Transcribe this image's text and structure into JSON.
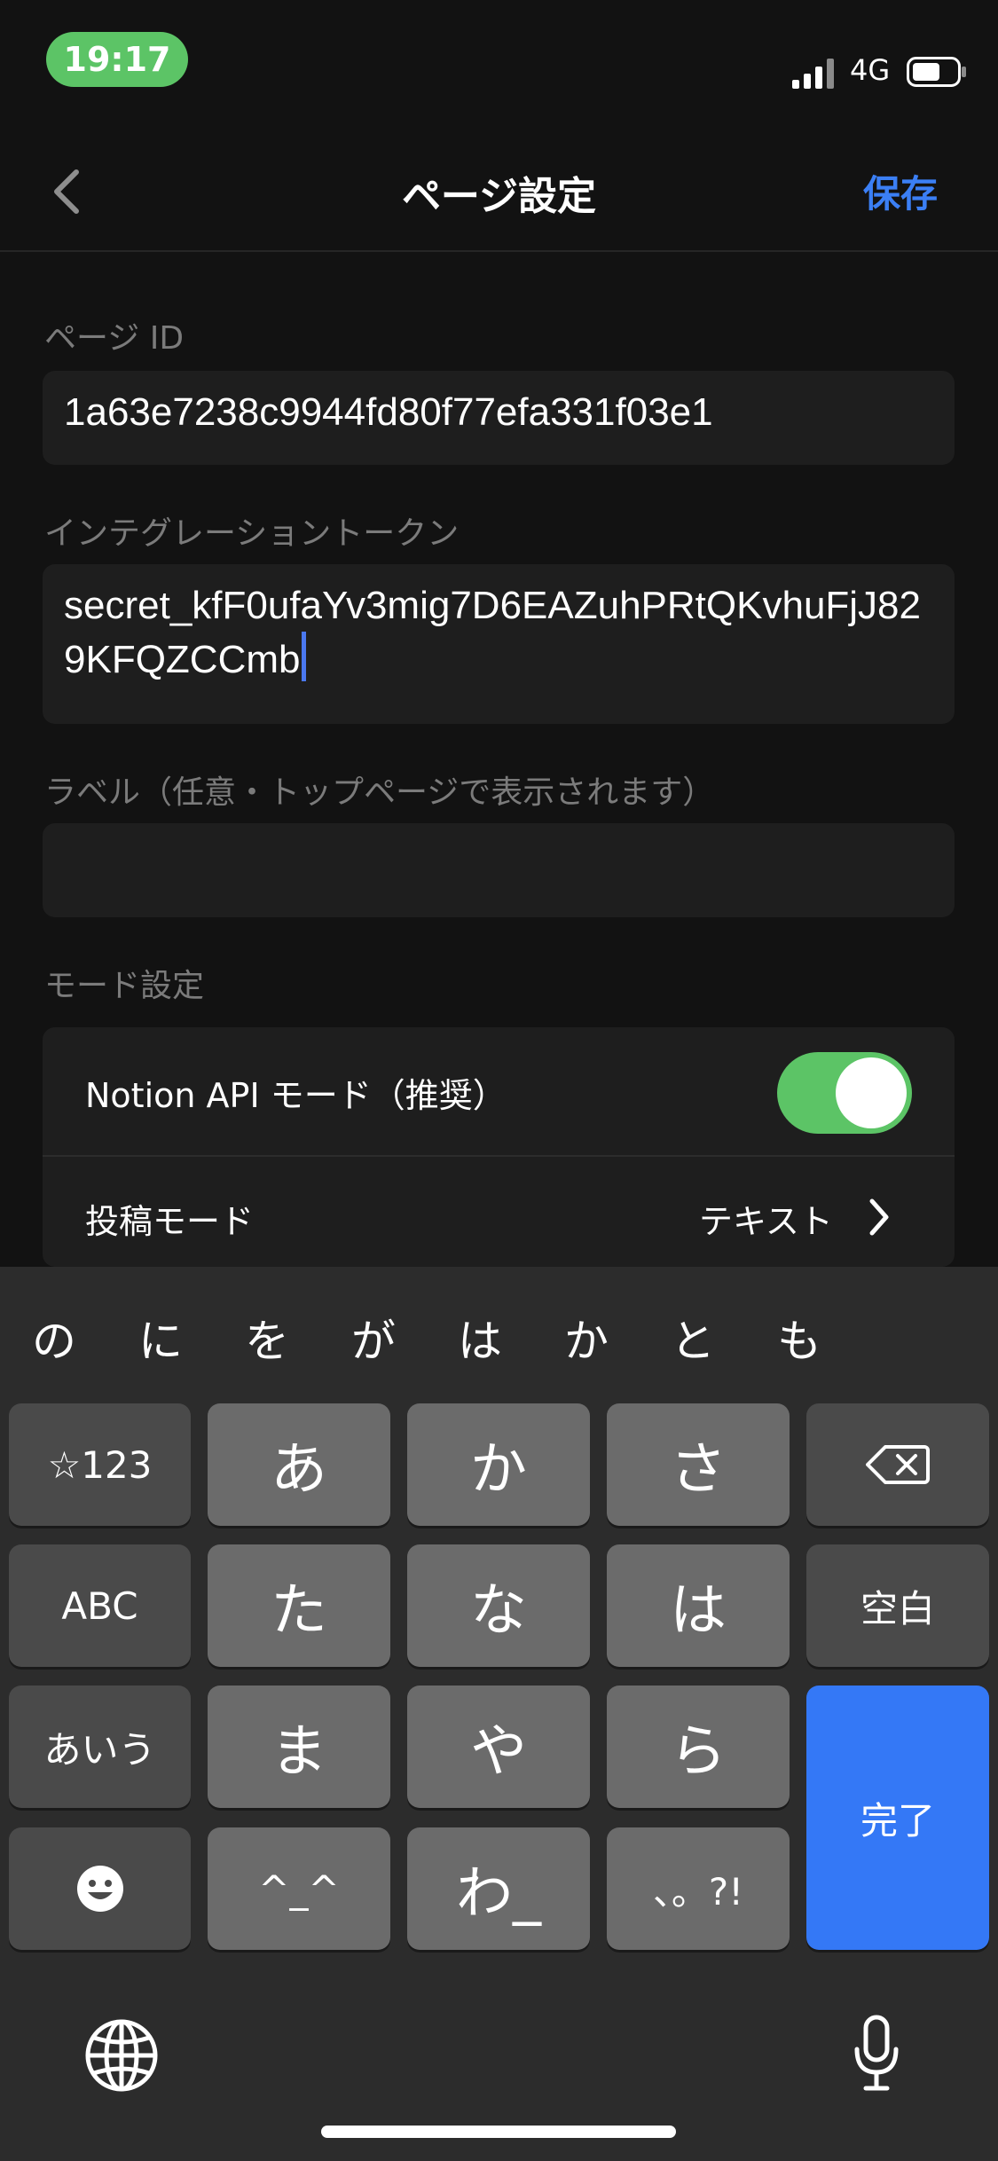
{
  "status_bar": {
    "time": "19:17",
    "network": "4G"
  },
  "nav": {
    "title": "ページ設定",
    "save": "保存"
  },
  "form": {
    "page_id_label": "ページ ID",
    "page_id_value": "1a63e7238c9944fd80f77efa331f03e1",
    "token_label": "インテグレーショントークン",
    "token_value": "secret_kfF0ufaYv3mig7D6EAZuhPRtQKvhuFjJ829KFQZCCmb",
    "label_label": "ラベル（任意・トップページで表示されます）",
    "label_value": "",
    "mode_label": "モード設定",
    "notion_api_mode": "Notion API モード（推奨）",
    "notion_api_mode_on": true,
    "post_mode_label": "投稿モード",
    "post_mode_value": "テキスト"
  },
  "keyboard": {
    "candidates": [
      "の",
      "に",
      "を",
      "が",
      "は",
      "か",
      "と",
      "も"
    ],
    "keys": {
      "sym": "☆123",
      "a": "あ",
      "ka": "か",
      "sa": "さ",
      "abc": "ABC",
      "ta": "た",
      "na": "な",
      "ha": "は",
      "space": "空白",
      "kana": "あいう",
      "ma": "ま",
      "ya": "や",
      "ra": "ら",
      "done": "完了",
      "emoticon": "^_^",
      "wa": "わ_",
      "punct": "、。?!"
    }
  }
}
